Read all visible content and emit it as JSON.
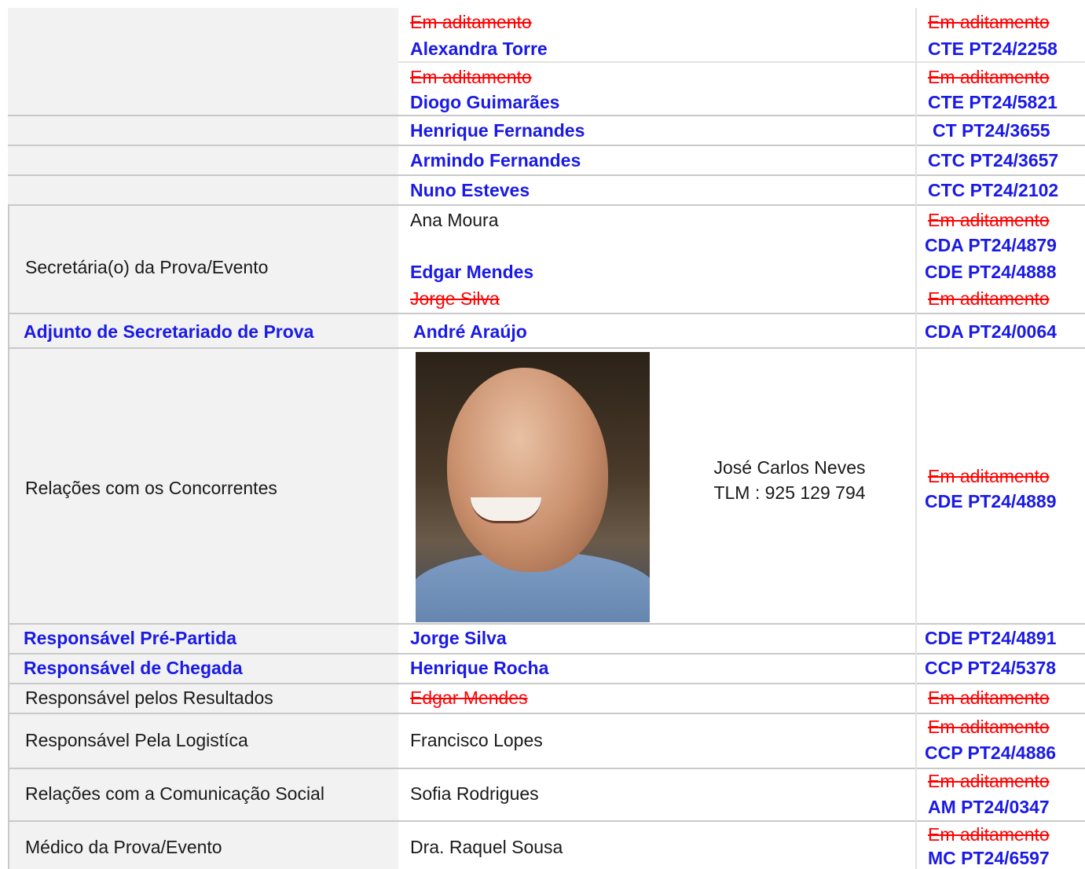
{
  "rows": {
    "r1": {
      "label": "",
      "name_struck": "Em aditamento",
      "name": "Alexandra Torre",
      "code_struck": "Em aditamento",
      "code": "CTE PT24/2258"
    },
    "r2": {
      "label": "",
      "name_struck": "Em aditamento",
      "name": "Diogo Guimarães",
      "code_struck": "Em aditamento",
      "code": "CTE PT24/5821"
    },
    "r3": {
      "label": "",
      "name": "Henrique Fernandes",
      "code": "CT PT24/3655"
    },
    "r4": {
      "label": "",
      "name": "Armindo Fernandes",
      "code": "CTC PT24/3657"
    },
    "r5": {
      "label": "",
      "name": "Nuno Esteves",
      "code": "CTC PT24/2102"
    },
    "secretaria": {
      "label": "Secretária(o) da Prova/Evento",
      "name1": "Ana Moura",
      "name2": "Edgar Mendes",
      "name3_struck": "Jorge Silva",
      "code1_struck": "Em aditamento",
      "code2": "CDA PT24/4879",
      "code3": "CDE PT24/4888",
      "code4_struck": "Em aditamento"
    },
    "adjunto": {
      "label": "Adjunto de Secretariado de Prova",
      "name": "André Araújo",
      "code": "CDA PT24/0064"
    },
    "relacoes": {
      "label": "Relações com os Concorrentes",
      "contact_name": "José Carlos Neves",
      "contact_phone": "TLM : 925 129 794",
      "code_struck": "Em aditamento",
      "code": "CDE PT24/4889"
    },
    "pre_partida": {
      "label": "Responsável Pré-Partida",
      "name": "Jorge Silva",
      "code": "CDE PT24/4891"
    },
    "chegada": {
      "label": "Responsável de Chegada",
      "name": "Henrique Rocha",
      "code": "CCP PT24/5378"
    },
    "resultados": {
      "label": "Responsável pelos Resultados",
      "name_struck": "Edgar Mendes",
      "code_struck": "Em aditamento"
    },
    "logistica": {
      "label": "Responsável Pela Logistíca",
      "name": "Francisco Lopes",
      "code_struck": "Em aditamento",
      "code": "CCP PT24/4886"
    },
    "comunicacao": {
      "label": "Relações com a Comunicação Social",
      "name": "Sofia Rodrigues",
      "code_struck": "Em aditamento",
      "code": "AM PT24/0347"
    },
    "medico": {
      "label": "Médico da Prova/Evento",
      "name": "Dra. Raquel Sousa",
      "code_struck": "Em aditamento",
      "code": "MC PT24/6597"
    }
  },
  "colors": {
    "blue": "#1a1ae6",
    "red": "#ff0000",
    "label_bg": "#f2f2f2"
  },
  "photo": {
    "description_icon": "person-photo"
  }
}
